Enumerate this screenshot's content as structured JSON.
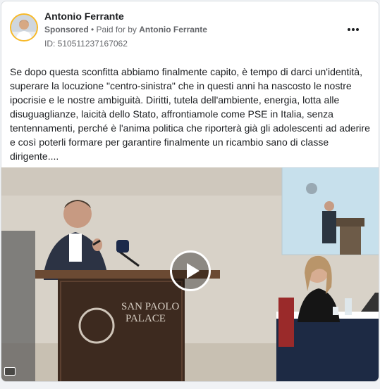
{
  "post": {
    "author": "Antonio Ferrante",
    "sponsored": "Sponsored",
    "separator": " • ",
    "paid_prefix": "Paid for by ",
    "paid_by": "Antonio Ferrante",
    "ad_id": "ID: 510511237167062",
    "body": "Se dopo questa sconfitta abbiamo finalmente capito, è tempo di darci un'identità, superare la locuzione \"centro-sinistra\" che in questi anni ha nascosto le nostre ipocrisie e le nostre ambiguità. Diritti, tutela dell'ambiente, energia, lotta alle disuguaglianze, laicità dello Stato, affrontiamole come PSE in Italia, senza tentennamenti, perché è l'anima politica che riporterà già gli adolescenti ad aderire e così poterli formare per garantire finalmente un ricambio sano di classe dirigente...."
  },
  "video": {
    "podium_sign_line1": "SAN PAOLO",
    "podium_sign_line2": "PALACE",
    "play_icon": "play-icon",
    "more_icon": "more-horizontal-icon"
  }
}
